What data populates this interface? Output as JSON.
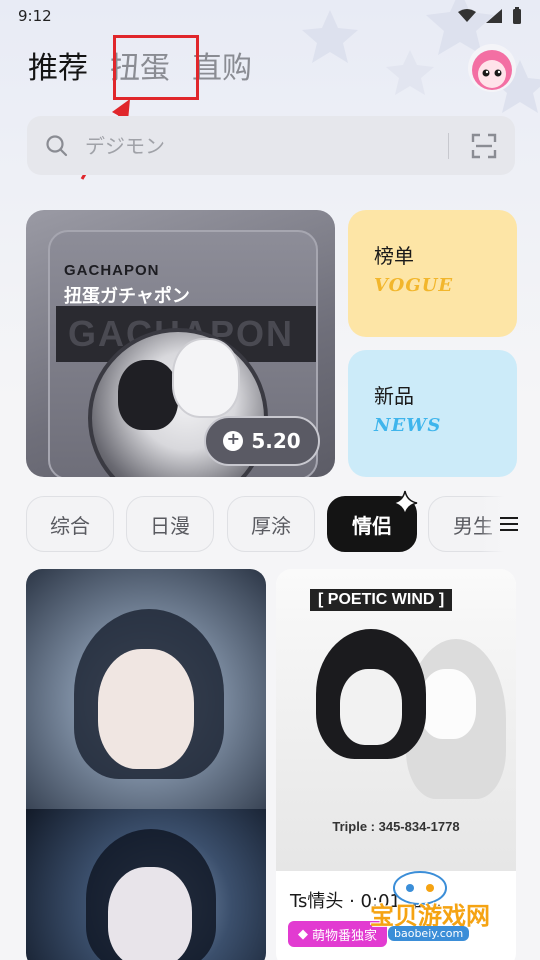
{
  "status_bar": {
    "time": "9:12"
  },
  "top_tabs": [
    {
      "label": "推荐",
      "active": true
    },
    {
      "label": "扭蛋",
      "active": false
    },
    {
      "label": "直购",
      "active": false
    }
  ],
  "search": {
    "placeholder": "デジモン"
  },
  "banner": {
    "brand": "GACHAPON",
    "subtitle": "扭蛋ガチャポン",
    "bg_text": "GACHAPON",
    "price": "5.20"
  },
  "side_cards": {
    "rank": {
      "title": "榜单",
      "deco": "VOGUE"
    },
    "new": {
      "title": "新品",
      "deco": "NEWS"
    }
  },
  "categories": [
    {
      "label": "综合"
    },
    {
      "label": "日漫"
    },
    {
      "label": "厚涂"
    },
    {
      "label": "情侣",
      "active": true
    },
    {
      "label": "男生"
    }
  ],
  "feed": {
    "right_card": {
      "poster_text": "[ POETIC WIND ]",
      "phone_text": "Triple : 345-834-1778",
      "title": "Ts情头 · 0:01 谁...",
      "badge": "萌物番独家"
    }
  },
  "watermark": {
    "text": "宝贝游戏网",
    "url": "baobeiy.com"
  },
  "colors": {
    "highlight": "#e0262b",
    "rank_bg": "#fde5a6",
    "new_bg": "#ccebf9",
    "badge": "#e23bd1"
  }
}
